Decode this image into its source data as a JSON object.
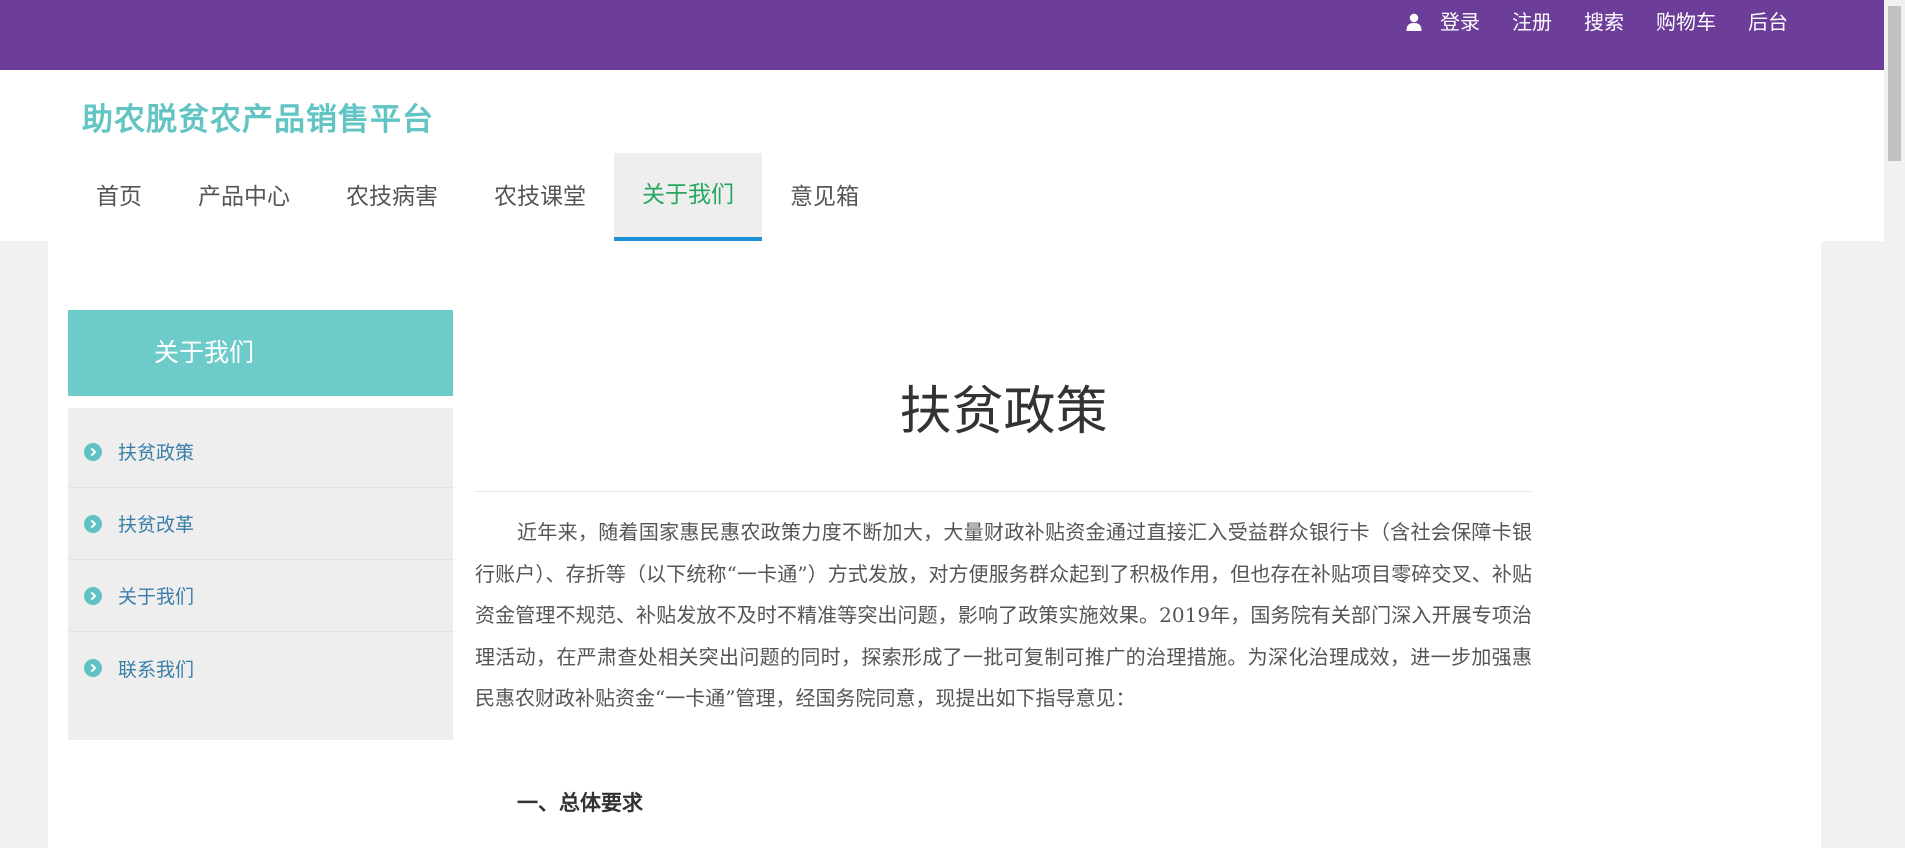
{
  "topbar": {
    "links": [
      "登录",
      "注册",
      "搜索",
      "购物车",
      "后台"
    ]
  },
  "site": {
    "title": "助农脱贫农产品销售平台"
  },
  "nav": {
    "items": [
      "首页",
      "产品中心",
      "农技病害",
      "农技课堂",
      "关于我们",
      "意见箱"
    ],
    "active": "关于我们"
  },
  "sidebar": {
    "heading": "关于我们",
    "items": [
      "扶贫政策",
      "扶贫改革",
      "关于我们",
      "联系我们"
    ]
  },
  "article": {
    "title": "扶贫政策",
    "body": "近年来，随着国家惠民惠农政策力度不断加大，大量财政补贴资金通过直接汇入受益群众银行卡（含社会保障卡银行账户）、存折等（以下统称“一卡通”）方式发放，对方便服务群众起到了积极作用，但也存在补贴项目零碎交叉、补贴资金管理不规范、补贴发放不及时不精准等突出问题，影响了政策实施效果。2019年，国务院有关部门深入开展专项治理活动，在严肃查处相关突出问题的同时，探索形成了一批可复制可推广的治理措施。为深化治理成效，进一步加强惠民惠农财政补贴资金“一卡通”管理，经国务院同意，现提出如下指导意见：",
    "section_heading": "一、总体要求"
  },
  "colors": {
    "topbar": "#6c3d99",
    "brand_teal": "#63c4c4",
    "nav_active_text": "#27a860",
    "nav_active_underline": "#1e90d8",
    "sidebar_link": "#3b7fa8"
  },
  "icons": {
    "user": "user-icon",
    "sidebar_bullet": "chevron-right-circle-icon"
  }
}
